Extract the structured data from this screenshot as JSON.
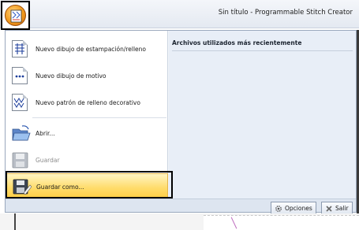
{
  "window": {
    "title": "Sin título - Programmable Stitch Creator"
  },
  "app_button": {
    "icon": "needle-grid-icon"
  },
  "menu": {
    "items": [
      {
        "label": "Nuevo dibujo de estampación/relleno",
        "icon": "new-fill-pattern-icon",
        "enabled": true
      },
      {
        "label": "Nuevo dibujo de motivo",
        "icon": "new-motif-icon",
        "enabled": true
      },
      {
        "label": "Nuevo patrón de relleno decorativo",
        "icon": "new-decorative-fill-icon",
        "enabled": true
      },
      {
        "label": "Abrir...",
        "icon": "open-folder-icon",
        "enabled": true
      },
      {
        "label": "Guardar",
        "icon": "save-icon",
        "enabled": false
      },
      {
        "label": "Guardar como...",
        "icon": "save-as-icon",
        "enabled": true,
        "highlighted": true
      }
    ],
    "recent": {
      "title": "Archivos utilizados más recientemente"
    },
    "options_button": "Opciones",
    "exit_button": "Salir"
  },
  "colors": {
    "highlight": "#ffd55a",
    "app_orange": "#f29a1c",
    "panel": "#e8eef7"
  }
}
